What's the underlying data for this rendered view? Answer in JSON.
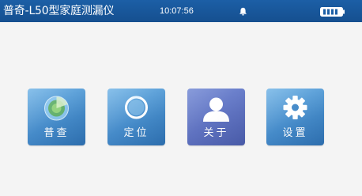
{
  "status_bar": {
    "title": "普奇-L50型家庭测漏仪",
    "time": "10:07:56",
    "bell_icon": "bell-icon",
    "battery_icon": "battery-full-icon",
    "background_color": "#1c5fa6"
  },
  "menu": {
    "tiles": [
      {
        "label": "普查",
        "icon": "radar-scan-icon",
        "color": "#3e86c7"
      },
      {
        "label": "定位",
        "icon": "locate-ring-icon",
        "color": "#3e86c7"
      },
      {
        "label": "关于",
        "icon": "user-icon",
        "color": "#5a6ebf"
      },
      {
        "label": "设置",
        "icon": "gear-icon",
        "color": "#3e86c7"
      }
    ]
  }
}
